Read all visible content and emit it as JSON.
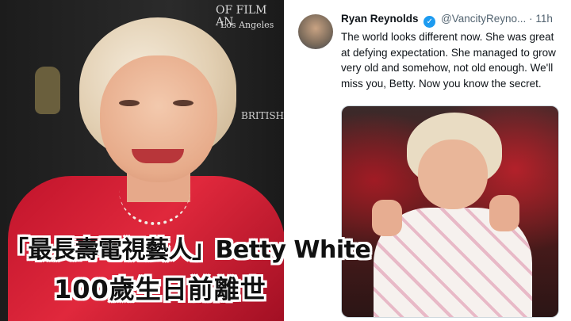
{
  "photo": {
    "backdrop_text_1": "OF FILM AN",
    "backdrop_text_2": "Los Angeles",
    "backdrop_text_3": "BRITISH"
  },
  "tweet": {
    "author_name": "Ryan Reynolds",
    "verified_symbol": "✓",
    "handle": "@VancityReyno...",
    "time": "· 11h",
    "text": "The world looks different now. She was great at defying expectation. She managed to grow very old and somehow, not old enough. We'll miss you, Betty. Now you know the secret."
  },
  "caption": {
    "line1": "「最長壽電視藝人」Betty White",
    "line2": "100歲生日前離世"
  },
  "colors": {
    "verified_blue": "#1d9bf0",
    "jacket_red": "#d0182f",
    "meta_gray": "#536471"
  }
}
